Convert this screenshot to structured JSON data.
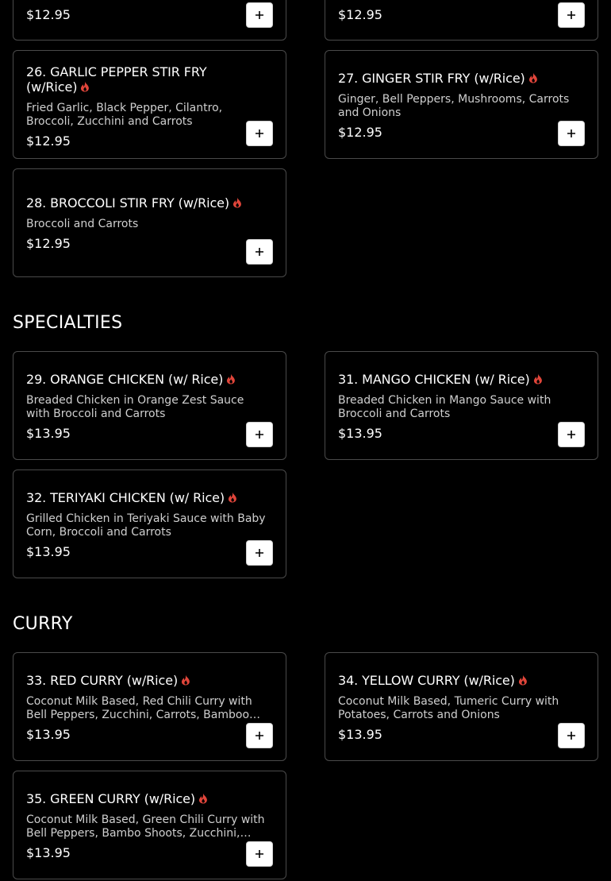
{
  "colors": {
    "background": "#000000",
    "card_border": "#4a4a4a",
    "spicy_icon": "#e0453a",
    "add_button_bg": "#ffffff"
  },
  "icons": {
    "spicy": "flame-icon",
    "add": "plus-icon"
  },
  "top_partial": {
    "left_price": "$12.95",
    "right_price": "$12.95"
  },
  "stir_fry": {
    "items": [
      {
        "title": "26. GARLIC PEPPER STIR FRY (w/Rice)",
        "description": "Fried Garlic, Black Pepper, Cilantro, Broccoli, Zucchini and Carrots",
        "price": "$12.95",
        "spicy": true
      },
      {
        "title": "27. GINGER STIR FRY (w/Rice)",
        "description": "Ginger, Bell Peppers, Mushrooms, Carrots and Onions",
        "price": "$12.95",
        "spicy": true
      },
      {
        "title": "28. BROCCOLI STIR FRY (w/Rice)",
        "description": "Broccoli and Carrots",
        "price": "$12.95",
        "spicy": true
      }
    ]
  },
  "specialties": {
    "heading": "SPECIALTIES",
    "items": [
      {
        "title": "29. ORANGE CHICKEN (w/ Rice)",
        "description": "Breaded Chicken in Orange Zest Sauce with Broccoli and Carrots",
        "price": "$13.95",
        "spicy": true
      },
      {
        "title": "31. MANGO CHICKEN (w/ Rice)",
        "description": "Breaded Chicken in Mango Sauce with Broccoli and Carrots",
        "price": "$13.95",
        "spicy": true
      },
      {
        "title": "32. TERIYAKI CHICKEN (w/ Rice)",
        "description": "Grilled Chicken in Teriyaki Sauce with Baby Corn, Broccoli and Carrots",
        "price": "$13.95",
        "spicy": true
      }
    ]
  },
  "curry": {
    "heading": "CURRY",
    "items": [
      {
        "title": "33. RED CURRY (w/Rice)",
        "description": "Coconut Milk Based, Red Chili Curry with Bell Peppers, Zucchini, Carrots, Bamboo Shoots and Thai Basil",
        "price": "$13.95",
        "spicy": true
      },
      {
        "title": "34. YELLOW CURRY (w/Rice)",
        "description": "Coconut Milk Based, Tumeric Curry with Potatoes, Carrots and Onions",
        "price": "$13.95",
        "spicy": true
      },
      {
        "title": "35. GREEN CURRY (w/Rice)",
        "description": "Coconut Milk Based, Green Chili Curry with Bell Peppers, Bambo Shoots, Zucchini, Carrots and Thai Basil",
        "price": "$13.95",
        "spicy": true
      }
    ]
  }
}
